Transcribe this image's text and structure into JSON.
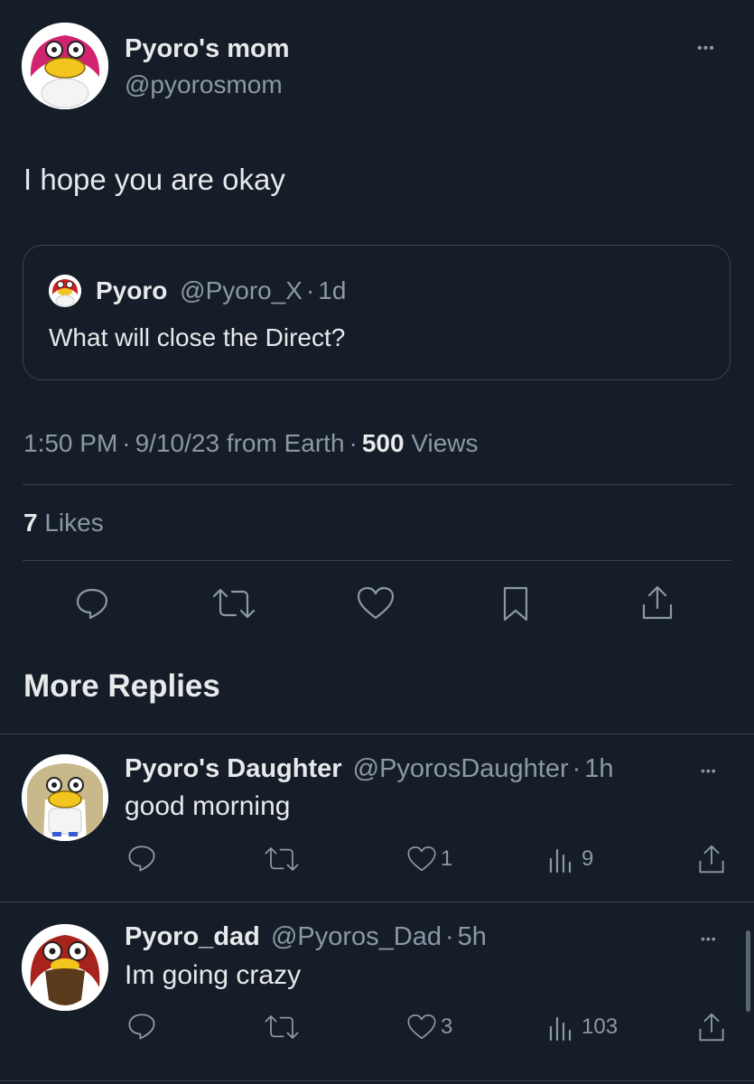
{
  "main_tweet": {
    "author_name": "Pyoro's mom",
    "author_handle": "@pyorosmom",
    "text": "I hope you are okay",
    "quote": {
      "author_name": "Pyoro",
      "author_handle": "@Pyoro_X",
      "time": "1d",
      "text": "What will close the Direct?"
    },
    "meta_time": "1:50 PM",
    "meta_date": "9/10/23",
    "meta_source": "from Earth",
    "views_count": "500",
    "views_label": "Views",
    "likes_count": "7",
    "likes_label": "Likes"
  },
  "section_title": "More Replies",
  "replies": [
    {
      "author_name": "Pyoro's Daughter",
      "author_handle": "@PyorosDaughter",
      "time": "1h",
      "text": "good morning",
      "likes": "1",
      "views": "9"
    },
    {
      "author_name": "Pyoro_dad",
      "author_handle": "@Pyoros_Dad",
      "time": "5h",
      "text": "Im going crazy",
      "likes": "3",
      "views": "103"
    }
  ],
  "separator": "·",
  "more_glyph": "•••",
  "colors": {
    "background": "#151d28",
    "text": "#e7e9ea",
    "muted": "#8b98a5",
    "border": "#38444d"
  }
}
